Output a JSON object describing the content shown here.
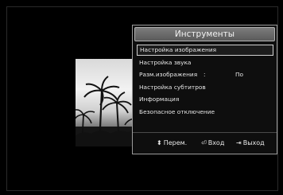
{
  "panel": {
    "title": "Инструменты",
    "items": [
      {
        "label": "Настройка изображения",
        "selected": true
      },
      {
        "label": "Настройка звука"
      },
      {
        "label": "Разм.изображения",
        "separator": ":",
        "value": "По"
      },
      {
        "label": "Настройка субтитров"
      },
      {
        "label": "Информация"
      },
      {
        "label": "Безопасное отключение"
      }
    ]
  },
  "footer": {
    "move_icon": "up-down-arrows-icon",
    "move_label": "Перем.",
    "enter_icon": "enter-icon",
    "enter_label": "Вход",
    "exit_icon": "exit-icon",
    "exit_label": "Выход"
  },
  "colors": {
    "background": "#000000",
    "panel_border": "#9a9a9a",
    "title_bar": "#6b6b6b",
    "text": "#e6e6e6"
  }
}
